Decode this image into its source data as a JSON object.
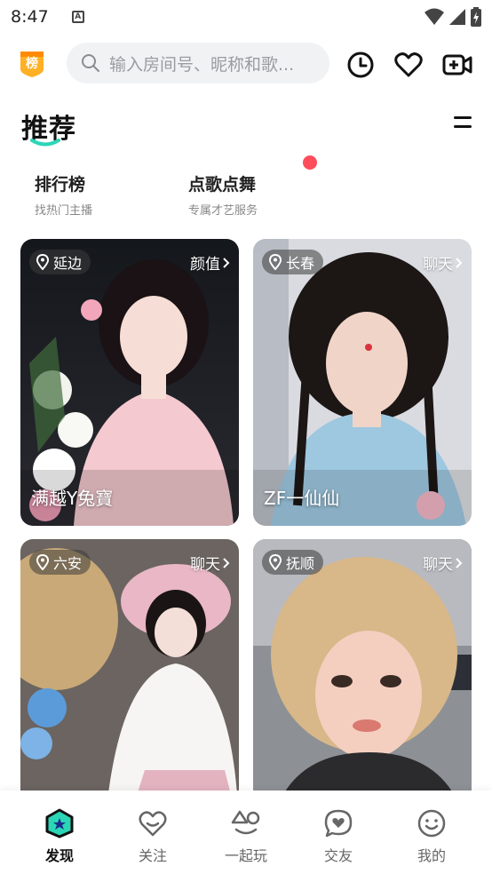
{
  "status_bar": {
    "time": "8:47"
  },
  "header": {
    "badge_label": "榜",
    "search": {
      "placeholder": "输入房间号、昵称和歌..."
    },
    "icons": [
      "history-icon",
      "heart-icon",
      "video-live-icon"
    ]
  },
  "section": {
    "title": "推荐"
  },
  "quick_links": [
    {
      "title": "排行榜",
      "subtitle": "找热门主播"
    },
    {
      "title": "点歌点舞",
      "subtitle": "专属才艺服务"
    }
  ],
  "cards": [
    {
      "location": "延边",
      "category": "颜值",
      "name": "满越Y兔寶"
    },
    {
      "location": "长春",
      "category": "聊天",
      "name": "ZF一仙仙"
    },
    {
      "location": "六安",
      "category": "聊天",
      "name": ""
    },
    {
      "location": "抚顺",
      "category": "聊天",
      "name": ""
    }
  ],
  "tabs": [
    {
      "label": "发现",
      "icon": "discover-icon",
      "active": true
    },
    {
      "label": "关注",
      "icon": "follow-heart-icon",
      "active": false
    },
    {
      "label": "一起玩",
      "icon": "play-together-icon",
      "active": false
    },
    {
      "label": "交友",
      "icon": "chat-bubble-icon",
      "active": false
    },
    {
      "label": "我的",
      "icon": "smiley-icon",
      "active": false
    }
  ],
  "colors": {
    "accent": "#2bd6b6",
    "badge": "#ff9f1a",
    "dot": "#ff4d5b"
  }
}
